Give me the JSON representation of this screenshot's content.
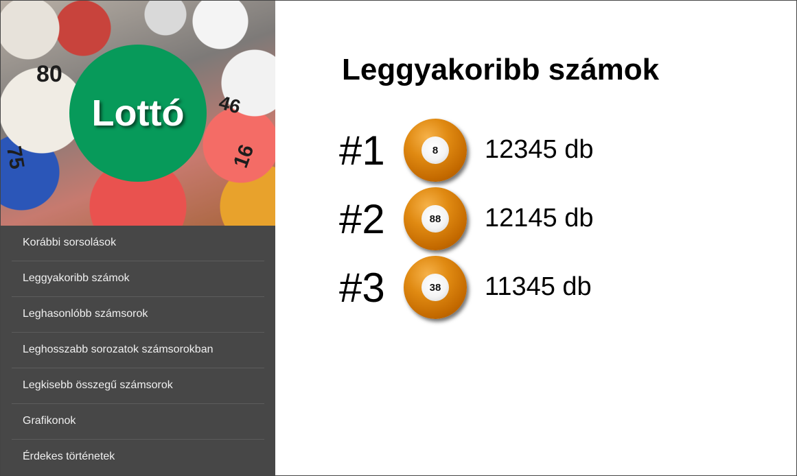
{
  "sidebar": {
    "logo_text": "Lottó",
    "hero_numbers": [
      "80",
      "46",
      "75",
      "16"
    ],
    "items": [
      {
        "label": "Korábbi sorsolások"
      },
      {
        "label": "Leggyakoribb számok"
      },
      {
        "label": "Leghasonlóbb számsorok"
      },
      {
        "label": "Leghosszabb sorozatok számsorokban"
      },
      {
        "label": "Legkisebb összegű számsorok"
      },
      {
        "label": "Grafikonok"
      },
      {
        "label": "Érdekes történetek"
      }
    ]
  },
  "main": {
    "title": "Leggyakoribb számok",
    "rankings": [
      {
        "rank": "#1",
        "number": "8",
        "count": "12345 db"
      },
      {
        "rank": "#2",
        "number": "88",
        "count": "12145 db"
      },
      {
        "rank": "#3",
        "number": "38",
        "count": "11345 db"
      }
    ]
  },
  "colors": {
    "sidebar_bg": "#474747",
    "logo_circle": "#079a5a",
    "ball_orange": "#e08a12"
  }
}
